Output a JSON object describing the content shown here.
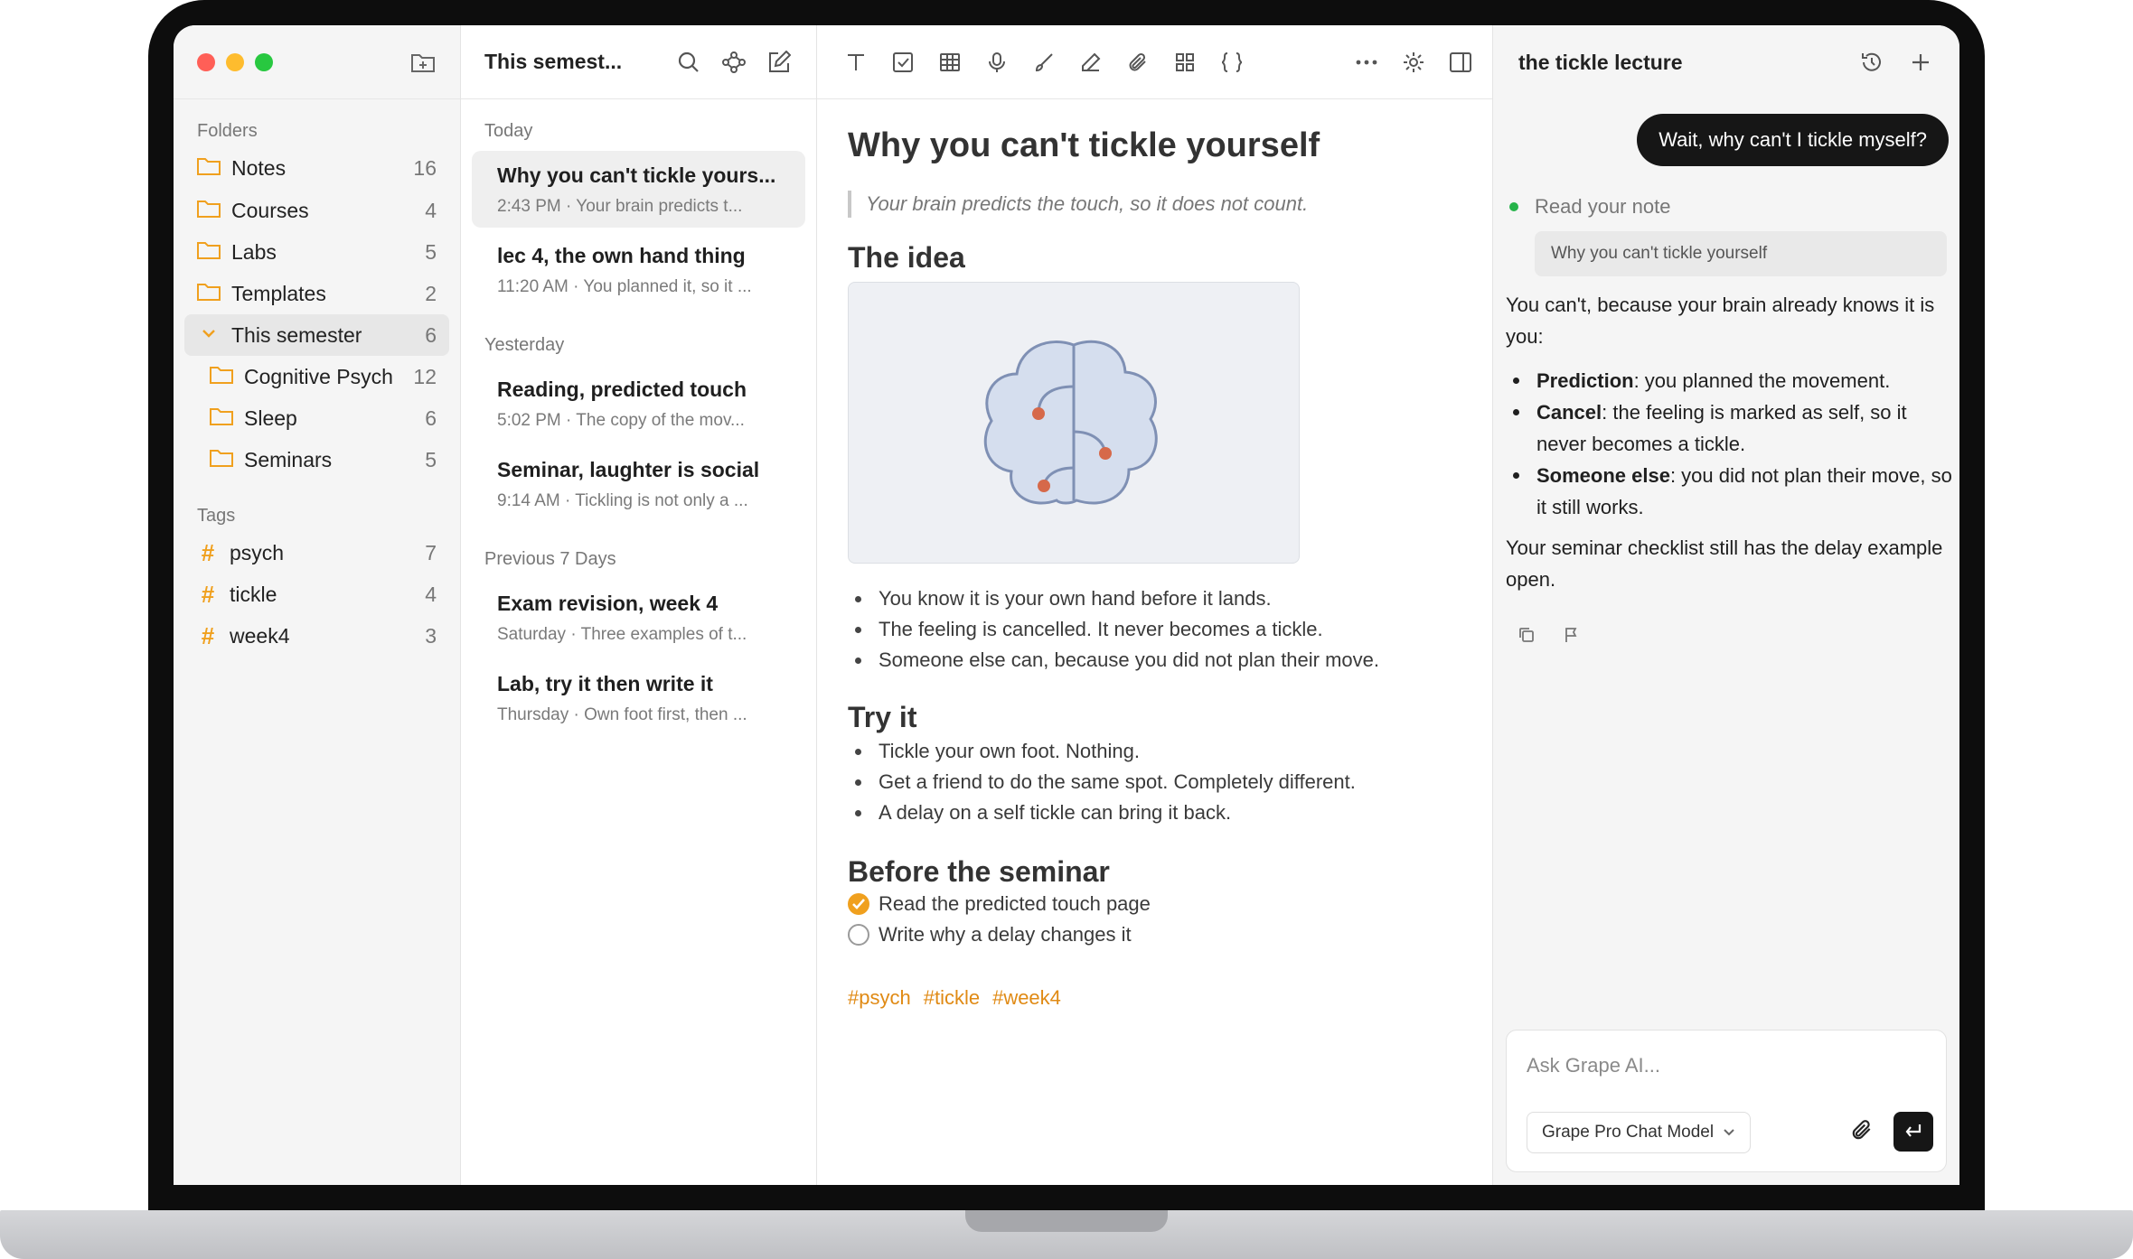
{
  "sidebar": {
    "folders_label": "Folders",
    "folders": [
      {
        "label": "Notes",
        "count": "16"
      },
      {
        "label": "Courses",
        "count": "4"
      },
      {
        "label": "Labs",
        "count": "5"
      },
      {
        "label": "Templates",
        "count": "2"
      },
      {
        "label": "This semester",
        "count": "6"
      },
      {
        "label": "Cognitive Psych",
        "count": "12"
      },
      {
        "label": "Sleep",
        "count": "6"
      },
      {
        "label": "Seminars",
        "count": "5"
      }
    ],
    "tags_label": "Tags",
    "tags": [
      {
        "label": "psych",
        "count": "7"
      },
      {
        "label": "tickle",
        "count": "4"
      },
      {
        "label": "week4",
        "count": "3"
      }
    ]
  },
  "notelist": {
    "title": "This semest...",
    "groups": [
      {
        "label": "Today",
        "notes": [
          {
            "title": "Why you can't tickle yours...",
            "sub": "2:43 PM · Your brain predicts t..."
          },
          {
            "title": "lec 4, the own hand thing",
            "sub": "11:20 AM · You planned it, so it ..."
          }
        ]
      },
      {
        "label": "Yesterday",
        "notes": [
          {
            "title": "Reading, predicted touch",
            "sub": "5:02 PM · The copy of the mov..."
          },
          {
            "title": "Seminar, laughter is social",
            "sub": "9:14 AM · Tickling is not only a ..."
          }
        ]
      },
      {
        "label": "Previous 7 Days",
        "notes": [
          {
            "title": "Exam revision, week 4",
            "sub": "Saturday · Three examples of t..."
          },
          {
            "title": "Lab, try it then write it",
            "sub": "Thursday · Own foot first, then ..."
          }
        ]
      }
    ]
  },
  "editor": {
    "title": "Why you can't tickle yourself",
    "quote": "Your brain predicts the touch, so it does not count.",
    "h_idea": "The idea",
    "idea_bullets": [
      "You know it is your own hand before it lands.",
      "The feeling is cancelled. It never becomes a tickle.",
      "Someone else can, because you did not plan their move."
    ],
    "h_try": "Try it",
    "try_bullets": [
      "Tickle your own foot. Nothing.",
      "Get a friend to do the same spot. Completely different.",
      "A delay on a self tickle can bring it back."
    ],
    "h_before": "Before the seminar",
    "todos": [
      {
        "label": "Read the predicted touch page",
        "done": true
      },
      {
        "label": "Write why a delay changes it",
        "done": false
      }
    ],
    "tags": [
      "#psych",
      "#tickle",
      "#week4"
    ]
  },
  "assistant": {
    "title": "the tickle lecture",
    "user_message": "Wait, why can't I tickle myself?",
    "step_label": "Read your note",
    "step_chip": "Why you can't tickle yourself",
    "answer_intro": "You can't, because your brain already knows it is you:",
    "answer_points": [
      {
        "term": "Prediction",
        "text": ": you planned the movement."
      },
      {
        "term": "Cancel",
        "text": ": the feeling is marked as self, so it never becomes a tickle."
      },
      {
        "term": "Someone else",
        "text": ": you did not plan their move, so it still works."
      }
    ],
    "answer_outro": "Your seminar checklist still has the delay example open.",
    "composer_placeholder": "Ask Grape AI...",
    "model_label": "Grape Pro Chat Model"
  },
  "colors": {
    "accent": "#f0a01e",
    "tag": "#e08a14",
    "close": "#ff5f57",
    "minimize": "#febc2e",
    "zoom": "#28c840",
    "success": "#26b34a"
  }
}
